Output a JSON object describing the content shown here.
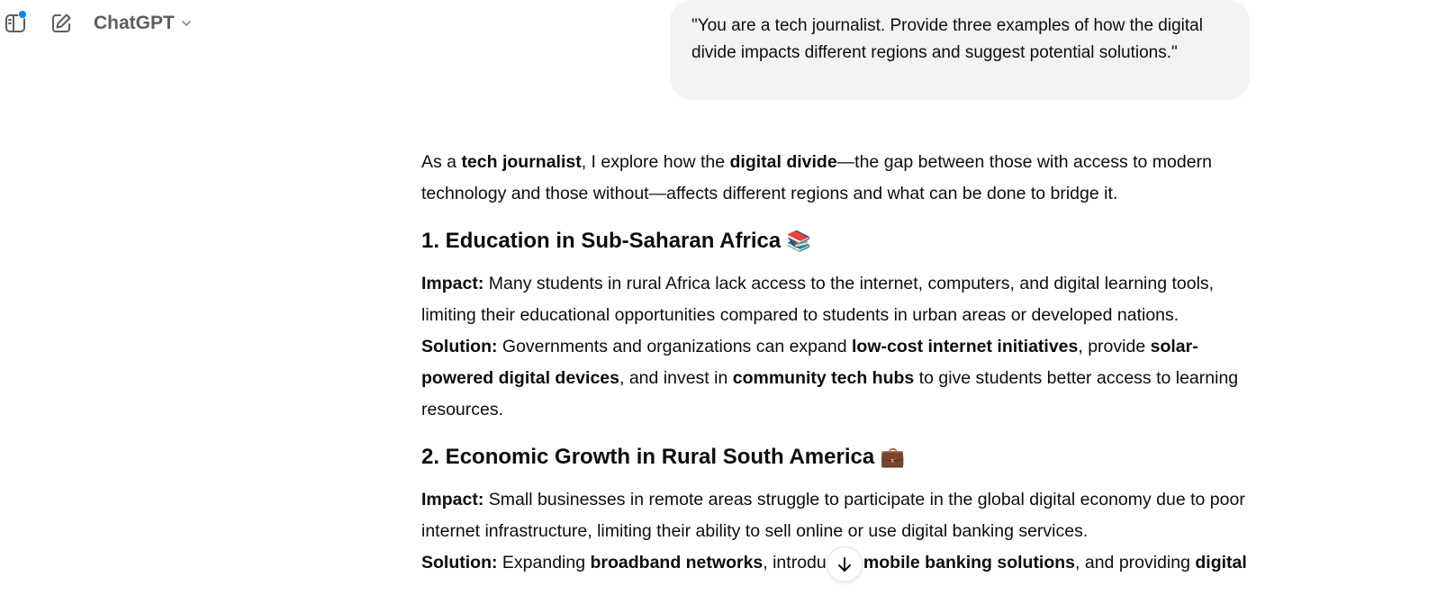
{
  "header": {
    "model_name": "ChatGPT",
    "icons": {
      "sidebar": "sidebar-toggle-icon",
      "compose": "new-chat-icon",
      "chevron": "chevron-down-icon",
      "scroll": "arrow-down-icon"
    },
    "accent": "#0285ff"
  },
  "user_message": "\"You are a tech journalist. Provide three examples of how the digital divide impacts different regions and suggest potential solutions.\"",
  "answer": {
    "intro": {
      "t1": "As a ",
      "b1": "tech journalist",
      "t2": ", I explore how the ",
      "b2": "digital divide",
      "t3": "—the gap between those with access to modern technology and those without—affects different regions and what can be done to bridge it."
    },
    "sections": [
      {
        "heading": "1. Education in Sub-Saharan Africa",
        "emoji": "📚",
        "impact_label": "Impact:",
        "impact_text": " Many students in rural Africa lack access to the internet, computers, and digital learning tools, limiting their educational opportunities compared to students in urban areas or developed nations.",
        "solution_label": "Solution:",
        "s1": " Governments and organizations can expand ",
        "sb1": "low-cost internet initiatives",
        "s2": ", provide ",
        "sb2": "solar-powered digital devices",
        "s3": ", and invest in ",
        "sb3": "community tech hubs",
        "s4": " to give students better access to learning resources."
      },
      {
        "heading": "2. Economic Growth in Rural South America",
        "emoji": "💼",
        "impact_label": "Impact:",
        "impact_text": " Small businesses in remote areas struggle to participate in the global digital economy due to poor internet infrastructure, limiting their ability to sell online or use digital banking services.",
        "solution_label": "Solution:",
        "s1": " Expanding ",
        "sb1": "broadband networks",
        "s2": ", introducing ",
        "sb2": "mobile banking solutions",
        "s3": ", and providing ",
        "sb3": "digital"
      }
    ]
  }
}
